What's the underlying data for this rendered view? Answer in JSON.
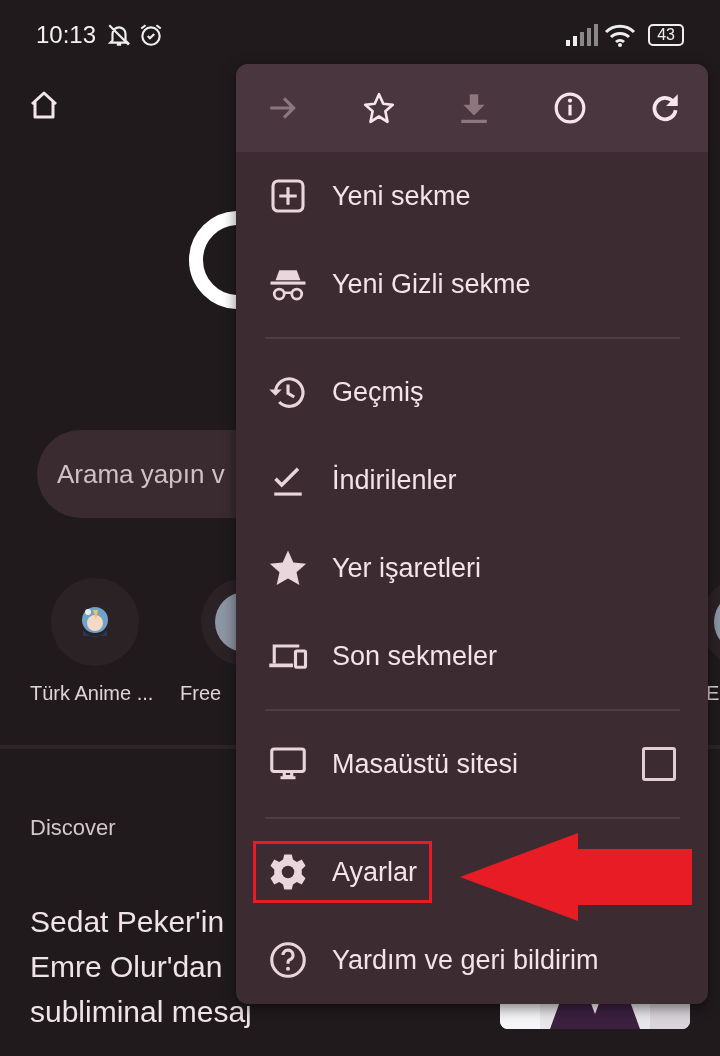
{
  "status_bar": {
    "time": "10:13",
    "battery": "43"
  },
  "search": {
    "placeholder": "Arama yapın v"
  },
  "shortcuts": [
    {
      "label": "Türk Anime ...",
      "kind": "picture"
    },
    {
      "label": "Free",
      "kind": "blank"
    },
    {
      "label": "E",
      "kind": "blank"
    }
  ],
  "discover": {
    "heading": "Discover",
    "article_lines": [
      "Sedat Peker'in",
      "Emre Olur'dan",
      "subliminal mesaj"
    ]
  },
  "menu": {
    "toolbar": [
      {
        "disabled": true
      },
      {
        "disabled": false
      },
      {
        "disabled": true
      },
      {
        "disabled": false
      },
      {
        "disabled": false
      }
    ],
    "items": [
      {
        "kind": "item",
        "label": "Yeni sekme",
        "highlighted": false
      },
      {
        "kind": "item",
        "label": "Yeni Gizli sekme",
        "highlighted": false
      },
      {
        "kind": "divider"
      },
      {
        "kind": "item",
        "label": "Geçmiş",
        "highlighted": false
      },
      {
        "kind": "item",
        "label": "İndirilenler",
        "highlighted": false
      },
      {
        "kind": "item",
        "label": "Yer işaretleri",
        "highlighted": false
      },
      {
        "kind": "item",
        "label": "Son sekmeler",
        "highlighted": false
      },
      {
        "kind": "divider"
      },
      {
        "kind": "checkbox",
        "label": "Masaüstü sitesi",
        "checked": false,
        "highlighted": false
      },
      {
        "kind": "divider"
      },
      {
        "kind": "item",
        "label": "Ayarlar",
        "highlighted": true
      },
      {
        "kind": "item",
        "label": "Yardım ve geri bildirim",
        "highlighted": false
      }
    ]
  }
}
